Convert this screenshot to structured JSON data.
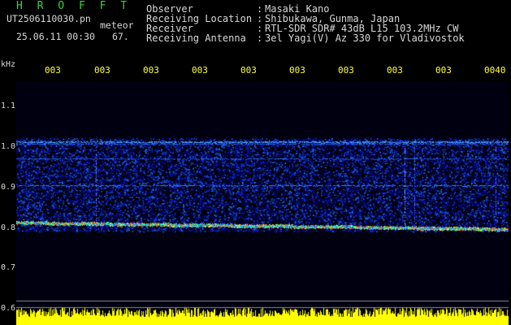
{
  "title": "H R O F F T",
  "file_name": "UT2506110030.pn",
  "meteor_label": "meteor",
  "datetime": "25.06.11 00:30",
  "count": "67.",
  "info": [
    {
      "label": "Observer",
      "value": "Masaki Kano"
    },
    {
      "label": "Receiving Location",
      "value": "Shibukawa, Gunma, Japan"
    },
    {
      "label": "Receiver",
      "value": "RTL-SDR SDR# 43dB L15 103.2MHz CW"
    },
    {
      "label": "Receiving Antenna",
      "value": "3el Yagi(V) Az 330 for Vladivostok"
    }
  ],
  "separator": ":",
  "freq_unit": "kHz",
  "time_ticks": [
    "003",
    "003",
    "003",
    "003",
    "003",
    "003",
    "003",
    "003",
    "003",
    "0040"
  ],
  "freq_ticks": [
    "1.1",
    "1.0",
    "0.9",
    "0.8",
    "0.7",
    "0.6"
  ],
  "colors": {
    "background": "#000000",
    "title": "#3bd13b",
    "ticks": "#ffff3b",
    "text": "#d8d8d8",
    "noise": "#1a2fd6",
    "histogram": "#ffff00"
  }
}
